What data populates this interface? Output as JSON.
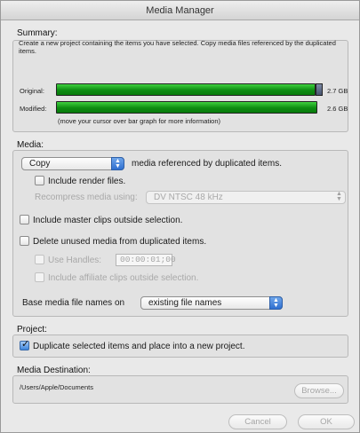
{
  "window": {
    "title": "Media Manager"
  },
  "summary": {
    "label": "Summary:",
    "description": "Create a new project containing the items you have selected. Copy media files referenced by the duplicated items.",
    "original_label": "Original:",
    "original_size": "2.7 GB",
    "modified_label": "Modified:",
    "modified_size": "2.6 GB",
    "hint": "(move your cursor over bar graph for more information)",
    "original_fill": 0.955,
    "modified_fill": 0.96
  },
  "media": {
    "label": "Media:",
    "mode_value": "Copy",
    "mode_suffix": "media referenced by duplicated items.",
    "include_render_label": "Include render files.",
    "include_render_checked": false,
    "recompress_label": "Recompress media using:",
    "recompress_value": "DV NTSC 48 kHz",
    "include_master_label": "Include master clips outside selection.",
    "include_master_checked": false,
    "delete_unused_label": "Delete unused media from duplicated items.",
    "delete_unused_checked": false,
    "use_handles_label": "Use Handles:",
    "handles_value": "00:00:01;00",
    "include_affiliate_label": "Include affiliate clips outside selection.",
    "base_names_label": "Base media file names on",
    "base_names_value": "existing file names"
  },
  "project": {
    "label": "Project:",
    "duplicate_label": "Duplicate selected items and place into a new project.",
    "duplicate_checked": true
  },
  "destination": {
    "label": "Media Destination:",
    "path": "/Users/Apple/Documents",
    "browse_label": "Browse..."
  },
  "footer": {
    "cancel_label": "Cancel",
    "ok_label": "OK"
  },
  "colors": {
    "bar_green": "#0d8d12",
    "accent_blue": "#2f6fd0"
  }
}
